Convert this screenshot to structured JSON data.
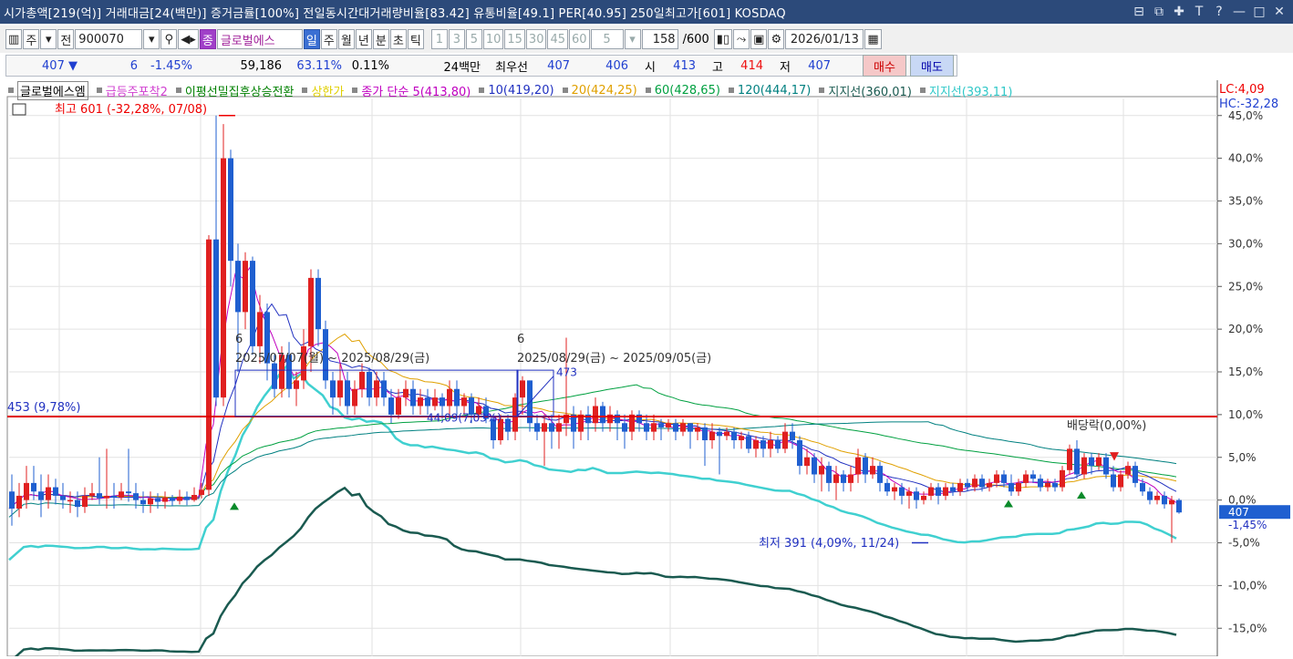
{
  "titlebar": {
    "text": "시가총액[219(억)] 거래대금[24(백만)] 증거금률[100%] 전일동시간대거래량비율[83.42] 유통비율[49.1] PER[40.95] 250일최고가[601] KOSDAQ",
    "buttons": [
      "⊟",
      "⧉",
      "✚",
      "T",
      "?",
      "—",
      "□",
      "✕"
    ]
  },
  "toolbar": {
    "stock_type": "주",
    "prev_label": "전",
    "code": "900070",
    "name_badge": "종",
    "stock_name": "글로벌에스",
    "periods": [
      "일",
      "주",
      "월",
      "년",
      "분",
      "초",
      "틱"
    ],
    "selected_period": "일",
    "intervals": [
      "1",
      "3",
      "5",
      "10",
      "15",
      "30",
      "45",
      "60"
    ],
    "interval_select": "5",
    "count": "158",
    "count_total": "/600",
    "date": "2026/01/13"
  },
  "quote": {
    "price": "407",
    "change": "6",
    "change_pct": "-1.45%",
    "volume": "59,186",
    "vol_ratio": "63.11%",
    "turnover": "0.11%",
    "amount": "24백만",
    "best_label": "최우선",
    "ask": "407",
    "bid": "406",
    "open_label": "시",
    "open": "413",
    "high_label": "고",
    "high": "414",
    "low_label": "저",
    "low": "407",
    "buy": "매수",
    "sell": "매도"
  },
  "legend": {
    "items": [
      {
        "text": "글로벌에스엠",
        "color": "#000000"
      },
      {
        "text": "급등주포착2",
        "color": "#d040d0"
      },
      {
        "text": "이평선밀집후상승전환",
        "color": "#008000"
      },
      {
        "text": "상한가",
        "color": "#e0d000"
      },
      {
        "text": "종가 단순 5(413,80)",
        "color": "#c000c0"
      },
      {
        "text": "10(419,20)",
        "color": "#2030c0"
      },
      {
        "text": "20(424,25)",
        "color": "#e0a000"
      },
      {
        "text": "60(428,65)",
        "color": "#00a040"
      },
      {
        "text": "120(444,17)",
        "color": "#008080"
      },
      {
        "text": "지지선(360,01)",
        "color": "#1a5a50"
      },
      {
        "text": "지지선(393,11)",
        "color": "#30c8c8"
      }
    ],
    "lc": "LC:4,09",
    "hc": "HC:-32,28"
  },
  "annotations": {
    "high": "최고 601 (-32,28%, 07/08)",
    "low": "최저 391 (4,09%, 11/24)",
    "hline": "453 (9,78%)",
    "box1_num": "6",
    "box1_range": "2025/07/07(월) ~ 2025/08/29(금)",
    "box2_num": "6",
    "box2_range": "2025/08/29(금) ~ 2025/09/05(금)",
    "box2_top": "473",
    "mid_label": "44,09(7,03%)",
    "dividend": "배당락(0,00%)",
    "current_price": "407",
    "current_pct": "-1,45%"
  },
  "chart_data": {
    "type": "candlestick",
    "y_axis_unit": "%",
    "ylim": [
      -17,
      47
    ],
    "yticks": [
      45,
      40,
      35,
      30,
      25,
      20,
      15,
      10,
      5,
      0,
      -5,
      -10,
      -15
    ],
    "ytick_labels": [
      "45,0%",
      "40,0%",
      "35,0%",
      "30,0%",
      "25,0%",
      "20,0%",
      "15,0%",
      "10,0%",
      "5,0%",
      "0,0%",
      "-5,0%",
      "-10,0%",
      "-15,0%"
    ],
    "reference_line": 9.78,
    "candles_anchor": [
      [
        0,
        1,
        -1,
        3,
        -3
      ],
      [
        8,
        -1,
        0.5,
        2,
        -2
      ],
      [
        16,
        0,
        2,
        4,
        -1
      ],
      [
        24,
        2,
        1,
        4,
        0
      ],
      [
        32,
        1,
        0,
        3,
        -2
      ],
      [
        40,
        0,
        1.5,
        3,
        -1
      ],
      [
        48,
        1.5,
        0.5,
        2.5,
        -0.5
      ],
      [
        56,
        0.5,
        0,
        2,
        -1
      ],
      [
        64,
        0,
        0,
        1,
        -1.5
      ],
      [
        72,
        0,
        -0.8,
        1,
        -2
      ],
      [
        80,
        -0.8,
        0.5,
        1.5,
        -1.5
      ],
      [
        88,
        0.5,
        0.8,
        2,
        0
      ],
      [
        96,
        0.8,
        0.2,
        5,
        -0.5
      ],
      [
        104,
        0.2,
        0.5,
        6,
        -1
      ],
      [
        112,
        0.5,
        0.3,
        2,
        -1
      ],
      [
        120,
        0.3,
        1,
        2,
        0
      ],
      [
        128,
        1,
        0.8,
        6,
        -0.2
      ],
      [
        136,
        0.8,
        0,
        2,
        -1
      ],
      [
        144,
        0,
        -0.5,
        1,
        -1.5
      ],
      [
        152,
        -0.5,
        0.2,
        1,
        -1.5
      ],
      [
        160,
        0.2,
        -0.2,
        0.8,
        -1
      ],
      [
        168,
        -0.2,
        0.3,
        1,
        -1
      ],
      [
        176,
        0.3,
        -0.1,
        0.6,
        -0.7
      ],
      [
        184,
        -0.1,
        0.4,
        1.2,
        -0.5
      ],
      [
        192,
        0.4,
        0,
        1,
        -0.6
      ],
      [
        200,
        0,
        0.6,
        1.5,
        -0.2
      ],
      [
        208,
        0.6,
        1.2,
        2,
        0.2
      ],
      [
        216,
        1.2,
        30.5,
        31,
        0.5
      ],
      [
        224,
        30.5,
        12,
        45,
        11
      ],
      [
        232,
        12,
        40,
        44,
        11
      ],
      [
        240,
        40,
        28,
        41,
        25
      ],
      [
        248,
        28,
        22,
        30,
        15
      ],
      [
        256,
        22,
        28,
        29,
        20
      ],
      [
        264,
        28,
        18,
        28.5,
        17
      ],
      [
        272,
        18,
        22,
        24,
        16
      ],
      [
        280,
        22,
        16,
        23,
        14
      ],
      [
        288,
        16,
        13,
        17,
        12
      ],
      [
        296,
        13,
        17,
        18,
        12
      ],
      [
        304,
        17,
        13,
        18.5,
        12
      ],
      [
        312,
        13,
        14,
        15,
        11
      ],
      [
        320,
        14,
        18,
        20,
        13
      ],
      [
        328,
        18,
        26,
        27,
        15
      ],
      [
        336,
        26,
        20,
        27,
        18
      ],
      [
        344,
        20,
        14,
        21,
        13
      ],
      [
        352,
        14,
        12,
        15,
        10
      ],
      [
        360,
        12,
        14,
        16,
        11
      ],
      [
        368,
        14,
        11,
        15,
        10
      ],
      [
        376,
        11,
        13,
        14,
        10
      ],
      [
        384,
        13,
        15,
        16,
        12
      ],
      [
        392,
        15,
        12,
        15.5,
        11
      ],
      [
        400,
        12,
        14,
        15,
        11
      ],
      [
        408,
        14,
        12,
        15,
        11
      ],
      [
        416,
        12,
        10,
        13,
        9
      ],
      [
        424,
        10,
        12,
        13,
        9.5
      ],
      [
        432,
        12,
        13,
        14,
        11
      ],
      [
        440,
        13,
        11,
        14,
        10
      ],
      [
        448,
        11,
        12,
        13,
        10
      ],
      [
        456,
        12,
        11,
        13,
        10
      ],
      [
        464,
        11,
        12,
        13,
        10.5
      ],
      [
        472,
        12,
        11,
        12.5,
        9.5
      ],
      [
        480,
        11,
        13,
        14,
        10
      ],
      [
        488,
        13,
        11,
        14,
        10
      ],
      [
        496,
        11,
        12,
        12.5,
        10
      ],
      [
        504,
        12,
        10,
        12.5,
        9
      ],
      [
        512,
        10,
        11,
        12,
        9.5
      ],
      [
        520,
        11,
        9.5,
        12,
        9
      ],
      [
        528,
        9.5,
        7,
        10,
        6
      ],
      [
        536,
        7,
        9.5,
        10,
        6.5
      ],
      [
        544,
        9.5,
        8,
        10,
        7
      ],
      [
        552,
        8,
        12,
        12.5,
        7
      ],
      [
        560,
        12,
        14,
        14.5,
        10
      ],
      [
        568,
        14,
        9,
        14,
        8
      ],
      [
        576,
        9,
        8,
        10,
        7
      ],
      [
        584,
        8,
        9,
        10,
        4
      ],
      [
        592,
        9,
        8,
        10,
        6
      ],
      [
        600,
        8,
        9,
        10,
        6
      ],
      [
        608,
        9,
        10,
        19,
        7.5
      ],
      [
        616,
        10,
        8,
        11,
        6
      ],
      [
        624,
        8,
        10,
        10.5,
        7
      ],
      [
        632,
        10,
        9,
        11,
        7
      ],
      [
        640,
        9,
        11,
        12,
        8
      ],
      [
        648,
        11,
        9,
        11.5,
        8
      ],
      [
        656,
        9,
        10,
        11,
        8
      ],
      [
        664,
        10,
        9,
        10.5,
        7
      ],
      [
        672,
        9,
        8,
        10,
        6
      ],
      [
        680,
        8,
        10,
        10.5,
        7
      ],
      [
        688,
        10,
        9,
        10.5,
        8
      ],
      [
        696,
        9,
        8,
        10,
        7
      ],
      [
        704,
        8,
        9,
        10,
        7
      ],
      [
        712,
        9,
        8.5,
        9.5,
        7
      ],
      [
        720,
        8.5,
        9,
        9.5,
        8
      ],
      [
        728,
        9,
        8,
        9.5,
        7
      ],
      [
        736,
        8,
        9,
        9.5,
        7.5
      ],
      [
        744,
        9,
        8,
        9,
        6
      ],
      [
        752,
        8,
        8.5,
        9,
        7
      ],
      [
        760,
        8.5,
        7,
        9,
        4
      ],
      [
        768,
        7,
        8,
        9,
        6
      ],
      [
        776,
        8,
        7.5,
        8.5,
        3
      ],
      [
        784,
        7.5,
        8,
        8.5,
        7
      ],
      [
        792,
        8,
        7,
        8.5,
        6
      ],
      [
        800,
        7,
        7.5,
        8,
        6
      ],
      [
        808,
        7.5,
        6,
        8,
        5.5
      ],
      [
        816,
        6,
        7,
        7.5,
        5
      ],
      [
        824,
        7,
        6,
        7.5,
        5
      ],
      [
        832,
        6,
        7,
        8,
        5
      ],
      [
        840,
        7,
        6,
        7.5,
        5.5
      ],
      [
        848,
        6,
        8,
        9,
        5.5
      ],
      [
        856,
        8,
        7,
        9,
        6
      ],
      [
        864,
        7,
        4,
        7.5,
        3
      ],
      [
        872,
        4,
        5,
        6,
        3
      ],
      [
        880,
        5,
        3,
        5.5,
        2
      ],
      [
        888,
        3,
        4,
        5,
        1
      ],
      [
        896,
        4,
        2,
        4.5,
        1
      ],
      [
        904,
        2,
        3,
        4,
        0
      ],
      [
        912,
        3,
        2,
        3.5,
        1
      ],
      [
        920,
        2,
        3,
        4,
        1
      ],
      [
        928,
        3,
        5,
        6,
        2
      ],
      [
        936,
        5,
        3,
        5.5,
        2
      ],
      [
        944,
        3,
        4,
        5,
        2.5
      ],
      [
        952,
        4,
        2,
        4.5,
        1
      ],
      [
        960,
        2,
        1,
        2.5,
        0.5
      ],
      [
        968,
        1,
        1.5,
        2,
        0
      ],
      [
        976,
        1.5,
        0.5,
        2,
        -0.5
      ],
      [
        984,
        0.5,
        1,
        1.5,
        -1
      ],
      [
        992,
        1,
        0,
        1.5,
        -1
      ],
      [
        1000,
        0,
        0.5,
        1,
        -0.5
      ],
      [
        1008,
        0.5,
        1.5,
        2,
        0
      ],
      [
        1016,
        1.5,
        0.5,
        2,
        -0.5
      ],
      [
        1024,
        0.5,
        1.5,
        2,
        0
      ],
      [
        1032,
        1.5,
        1,
        2,
        0.5
      ],
      [
        1040,
        1,
        2,
        2.5,
        0.5
      ],
      [
        1048,
        2,
        1.5,
        2.5,
        1
      ],
      [
        1056,
        1.5,
        2.5,
        3,
        1
      ],
      [
        1064,
        2.5,
        1.5,
        3,
        1
      ],
      [
        1072,
        1.5,
        2,
        2.5,
        1
      ],
      [
        1080,
        2,
        3,
        3.5,
        1.5
      ],
      [
        1088,
        3,
        2,
        3.5,
        1.5
      ],
      [
        1096,
        2,
        1,
        3,
        0.5
      ],
      [
        1104,
        1,
        2,
        2.5,
        0.5
      ],
      [
        1112,
        2,
        3,
        3.5,
        1.5
      ],
      [
        1120,
        3,
        2.5,
        3.5,
        2
      ],
      [
        1128,
        2.5,
        1.5,
        3,
        1
      ],
      [
        1136,
        1.5,
        2,
        2.5,
        1
      ],
      [
        1144,
        2,
        1.5,
        2.5,
        1
      ],
      [
        1152,
        1.5,
        3.5,
        4,
        1
      ],
      [
        1160,
        3.5,
        6,
        6.5,
        3
      ],
      [
        1168,
        6,
        3,
        7,
        2.5
      ],
      [
        1176,
        3,
        5,
        5.5,
        2.5
      ],
      [
        1184,
        5,
        4,
        5.5,
        3
      ],
      [
        1192,
        4,
        5,
        5.5,
        3.5
      ],
      [
        1200,
        5,
        3,
        5.5,
        2.5
      ],
      [
        1208,
        3,
        1.5,
        4,
        1
      ],
      [
        1216,
        1.5,
        3,
        3.5,
        1
      ],
      [
        1224,
        3,
        4,
        4.5,
        2.5
      ],
      [
        1232,
        4,
        2,
        4.5,
        1.5
      ],
      [
        1240,
        2,
        1,
        2.5,
        0.5
      ],
      [
        1248,
        1,
        0,
        1.5,
        -0.5
      ],
      [
        1256,
        0,
        0.5,
        1,
        -0.5
      ],
      [
        1264,
        0.5,
        -0.5,
        1,
        -1
      ],
      [
        1272,
        -0.5,
        0,
        0.5,
        -5
      ],
      [
        1280,
        0,
        -1.45,
        0.2,
        -1.6
      ]
    ]
  }
}
